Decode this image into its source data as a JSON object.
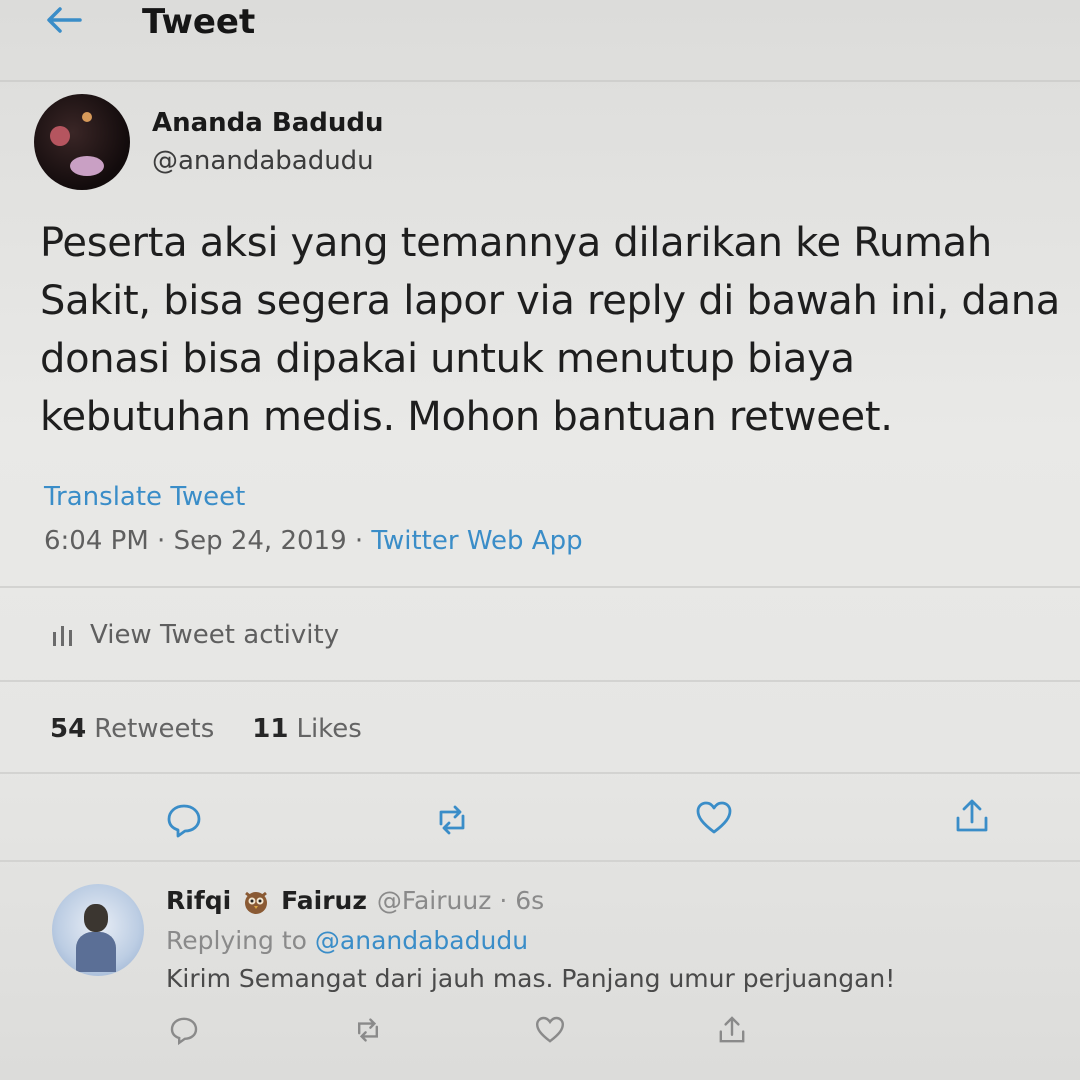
{
  "header": {
    "title": "Tweet",
    "back_icon": "arrow-left-icon"
  },
  "tweet": {
    "author_name": "Ananda Badudu",
    "author_handle": "@anandabadudu",
    "text": "Peserta aksi yang temannya dilarikan ke Rumah Sakit, bisa segera lapor via reply di bawah ini, dana donasi bisa dipakai untuk menutup biaya kebutuhan medis. Mohon bantuan retweet.",
    "translate_label": "Translate Tweet",
    "time": "6:04 PM",
    "date": "Sep 24, 2019",
    "source": "Twitter Web App",
    "separator": " · ",
    "activity_label": "View Tweet activity",
    "retweets_count": "54",
    "retweets_label": "Retweets",
    "likes_count": "11",
    "likes_label": "Likes"
  },
  "actions": [
    "reply-icon",
    "retweet-icon",
    "like-icon",
    "share-icon"
  ],
  "reply": {
    "name_first": "Rifqi",
    "name_emoji_icon": "owl-icon",
    "name_last": "Fairuz",
    "handle": "@Fairuuz",
    "time": "· 6s",
    "replying_prefix": "Replying to",
    "replying_to": "@anandabadudu",
    "text": "Kirim Semangat dari jauh mas. Panjang umur perjuangan!"
  },
  "colors": {
    "link": "#3a8dc8",
    "text": "#1e1e1e",
    "muted": "#5f5f5f"
  }
}
